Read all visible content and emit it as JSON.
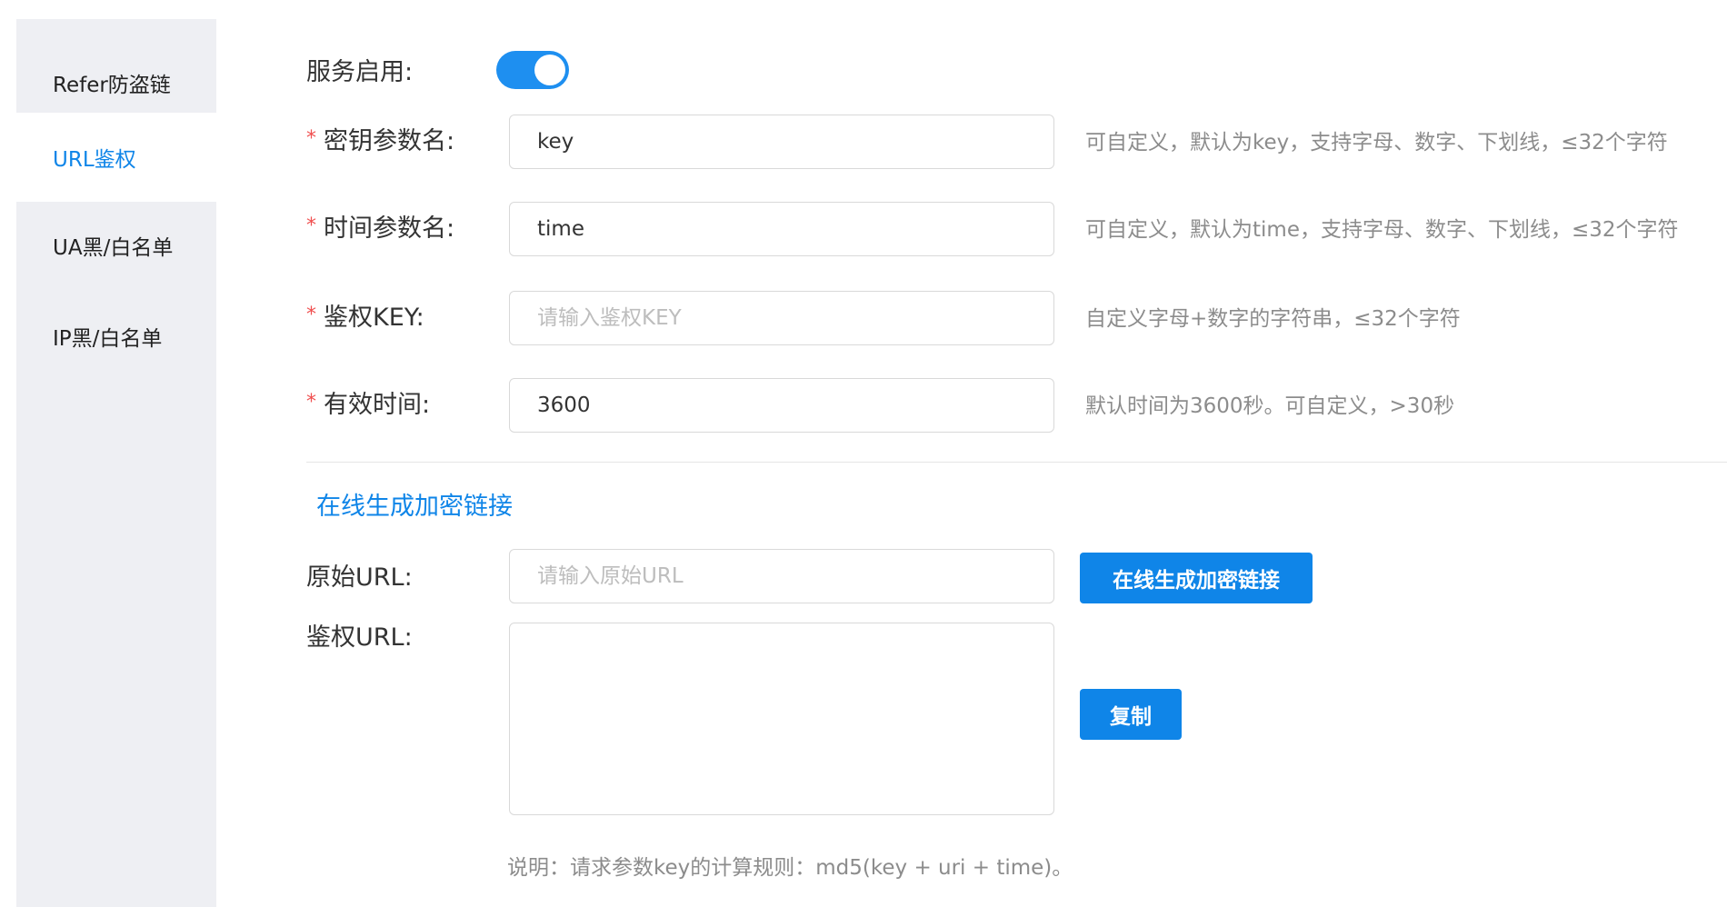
{
  "sidebar": {
    "items": [
      {
        "label": "Refer防盗链",
        "active": false
      },
      {
        "label": "URL鉴权",
        "active": true
      },
      {
        "label": "UA黑/白名单",
        "active": false
      },
      {
        "label": "IP黑/白名单",
        "active": false
      }
    ]
  },
  "form": {
    "service_enable": {
      "label": "服务启用:",
      "enabled": true
    },
    "key_param": {
      "label": "密钥参数名:",
      "value": "key",
      "hint": "可自定义，默认为key，支持字母、数字、下划线，≤32个字符"
    },
    "time_param": {
      "label": "时间参数名:",
      "value": "time",
      "hint": "可自定义，默认为time，支持字母、数字、下划线，≤32个字符"
    },
    "auth_key": {
      "label": "鉴权KEY:",
      "value": "",
      "placeholder": "请输入鉴权KEY",
      "hint": "自定义字母+数字的字符串，≤32个字符"
    },
    "valid_time": {
      "label": "有效时间:",
      "value": "3600",
      "hint": "默认时间为3600秒。可自定义，>30秒"
    },
    "required_mark": "*"
  },
  "generator": {
    "title": "在线生成加密链接",
    "origin_url": {
      "label": "原始URL:",
      "value": "",
      "placeholder": "请输入原始URL"
    },
    "generate_button": "在线生成加密链接",
    "auth_url": {
      "label": "鉴权URL:",
      "value": ""
    },
    "copy_button": "复制",
    "note": "说明：请求参数key的计算规则：md5(key + uri + time)。"
  },
  "colors": {
    "accent": "#0f85e8",
    "required": "#f05050",
    "sidebar_bg": "#eeeff3"
  }
}
